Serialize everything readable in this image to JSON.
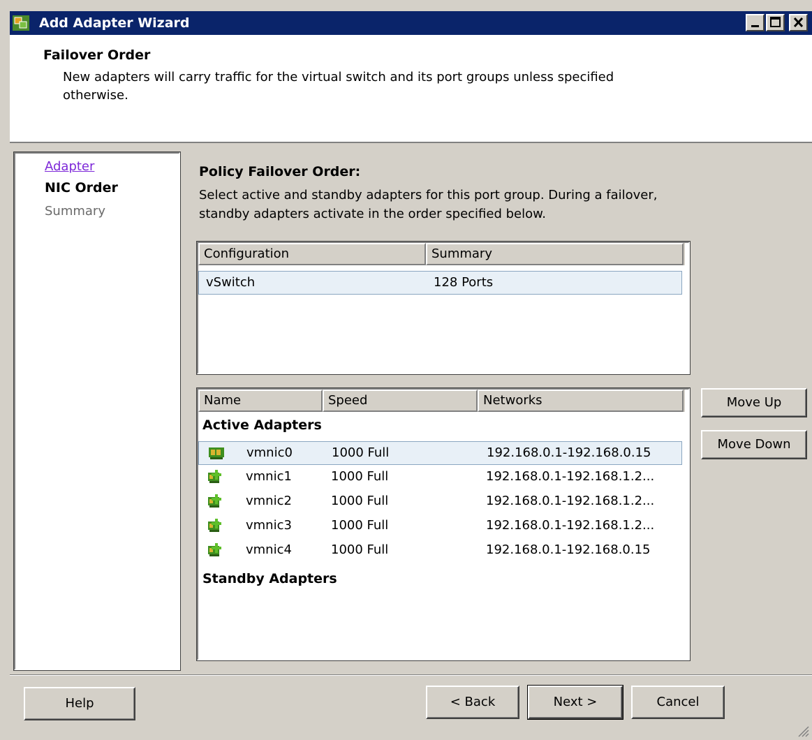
{
  "window": {
    "title": "Add Adapter Wizard"
  },
  "header": {
    "title": "Failover Order",
    "description": "New adapters will carry traffic for the virtual switch and its port groups unless specified otherwise."
  },
  "nav": {
    "items": [
      {
        "label": "Adapter",
        "state": "link"
      },
      {
        "label": "NIC Order",
        "state": "current"
      },
      {
        "label": "Summary",
        "state": "disabled"
      }
    ]
  },
  "policy": {
    "title": "Policy Failover Order:",
    "description": "Select active and standby adapters for this port group. During a failover, standby adapters activate in the order specified below."
  },
  "config_table": {
    "columns": [
      "Configuration",
      "Summary"
    ],
    "rows": [
      {
        "configuration": "vSwitch",
        "summary": "128 Ports"
      }
    ]
  },
  "nic_table": {
    "columns": [
      "Name",
      "Speed",
      "Networks"
    ],
    "active_label": "Active Adapters",
    "standby_label": "Standby Adapters",
    "active": [
      {
        "name": "vmnic0",
        "speed": "1000 Full",
        "networks": "192.168.0.1-192.168.0.15",
        "icon": "nic-connected-icon"
      },
      {
        "name": "vmnic1",
        "speed": "1000 Full",
        "networks": "192.168.0.1-192.168.1.2...",
        "icon": "nic-add-icon"
      },
      {
        "name": "vmnic2",
        "speed": "1000 Full",
        "networks": "192.168.0.1-192.168.1.2...",
        "icon": "nic-add-icon"
      },
      {
        "name": "vmnic3",
        "speed": "1000 Full",
        "networks": "192.168.0.1-192.168.1.2...",
        "icon": "nic-add-icon"
      },
      {
        "name": "vmnic4",
        "speed": "1000 Full",
        "networks": "192.168.0.1-192.168.0.15",
        "icon": "nic-add-icon"
      }
    ]
  },
  "buttons": {
    "move_up": "Move Up",
    "move_down": "Move Down",
    "help": "Help",
    "back": "< Back",
    "next": "Next >",
    "cancel": "Cancel"
  },
  "colors": {
    "titlebar": "#0a246a",
    "dialog": "#d4d0c8",
    "selected_row": "#e8f0f7",
    "visited_link": "#7d28d8"
  }
}
